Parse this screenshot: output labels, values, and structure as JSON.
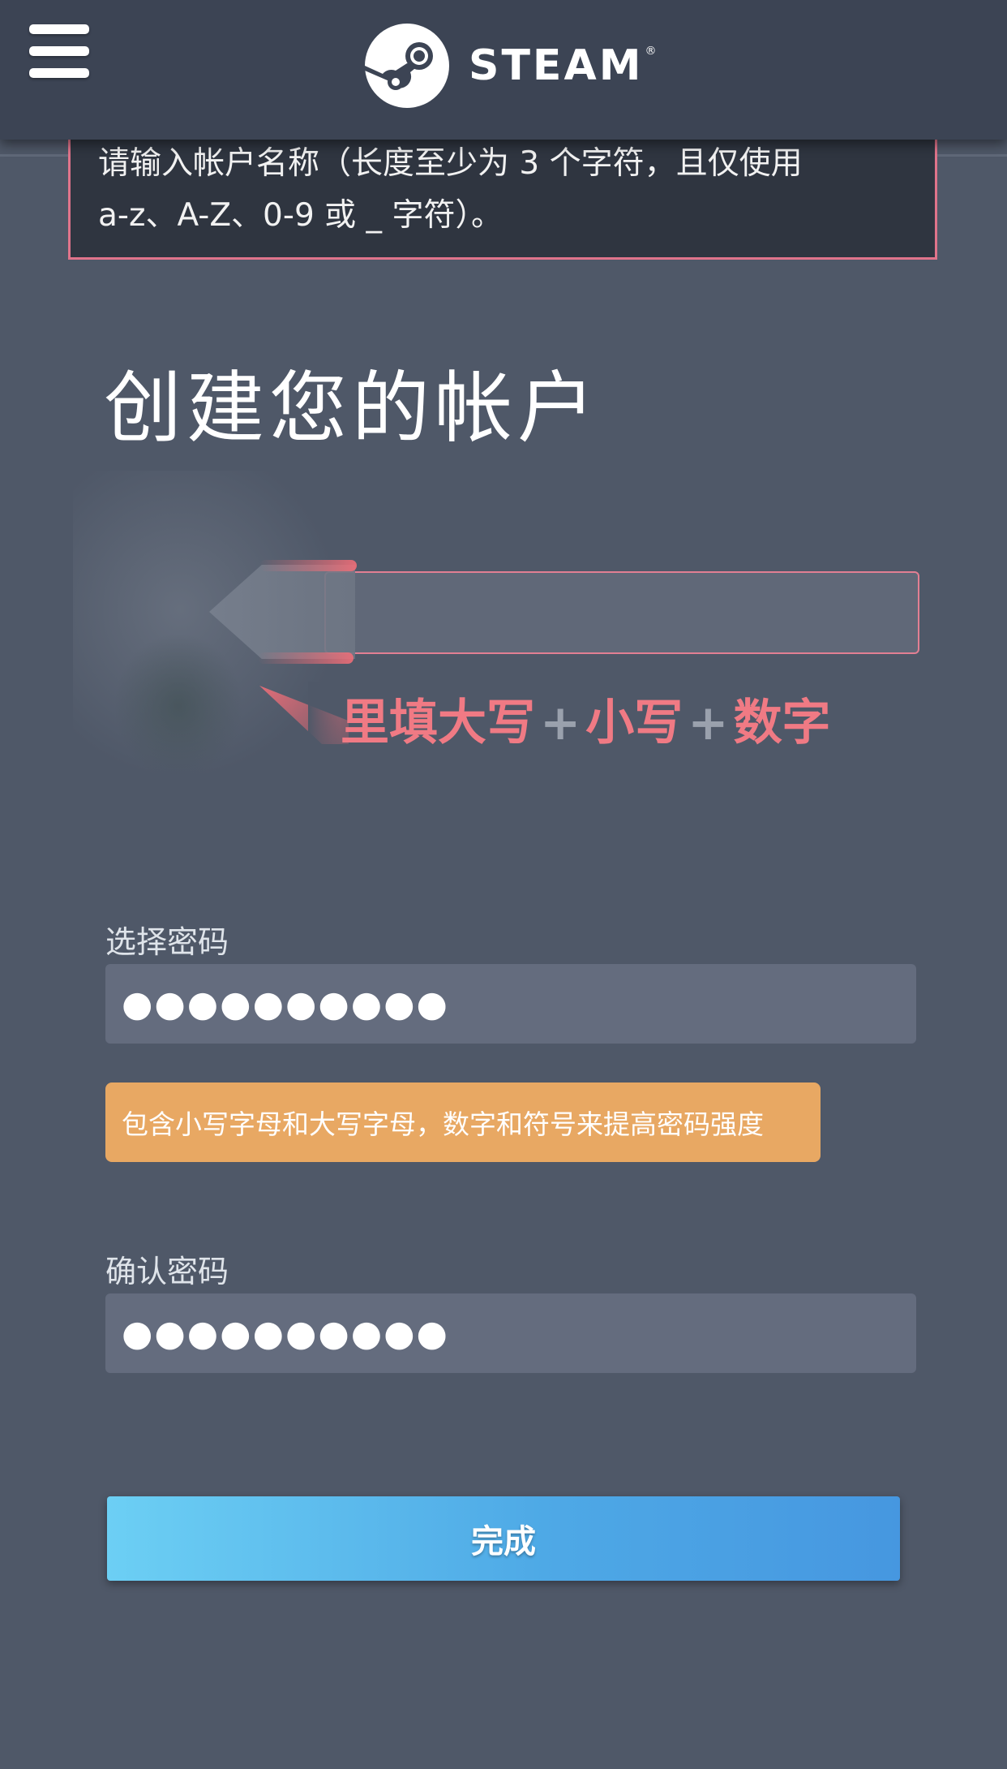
{
  "header": {
    "brand": "STEAM",
    "trademark": "®",
    "icons": [
      "hamburger-menu-icon",
      "steam-logo-icon"
    ]
  },
  "error": {
    "line1": "请输入帐户名称（长度至少为 3 个字符，且仅使用",
    "line2": "a-z、A-Z、0-9 或 _ 字符）。"
  },
  "page": {
    "title": "创建您的帐户"
  },
  "overlay": {
    "username_value": "",
    "hint_part1": "里填大写",
    "hint_plus1": "+",
    "hint_part2": "小写",
    "hint_plus2": "+",
    "hint_part3": "数字"
  },
  "password": {
    "label": "选择密码",
    "value": "●●●●●●●●●●",
    "tip": "包含小写字母和大写字母，数字和符号来提高密码强度"
  },
  "confirm": {
    "label": "确认密码",
    "value": "●●●●●●●●●●"
  },
  "submit": {
    "label": "完成"
  },
  "colors": {
    "background": "#4f5868",
    "header": "#3c4454",
    "error_border": "#e0748b",
    "hint_red": "#f07a84",
    "tip_orange": "#e8a863",
    "button_start": "#6ccff4",
    "button_end": "#4697e0"
  }
}
